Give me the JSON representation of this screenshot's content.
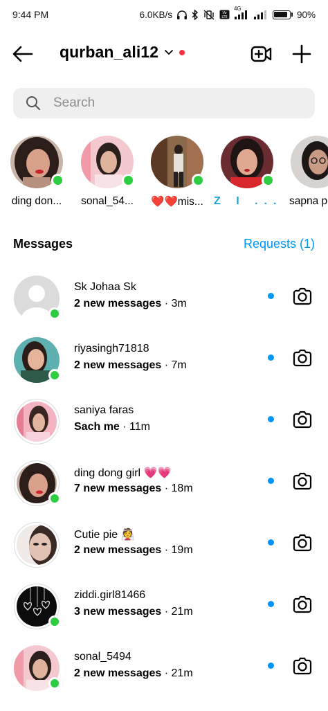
{
  "status_bar": {
    "time": "9:44 PM",
    "speed": "6.0KB/s",
    "network": "4G",
    "battery": "90",
    "battery_fraction": 0.9
  },
  "header": {
    "account_name": "qurban_ali12",
    "accent_red": "#ff3040"
  },
  "search": {
    "placeholder": "Search"
  },
  "stories": [
    {
      "label": "ding don...",
      "online": true
    },
    {
      "label": "sonal_54...",
      "online": true
    },
    {
      "label": "❤️❤️mis...",
      "online": true
    },
    {
      "label": "Z I ...",
      "online": true
    },
    {
      "label": "sapna p",
      "online": false
    }
  ],
  "messages_section": {
    "title": "Messages",
    "requests": "Requests (1)",
    "accent_blue": "#0095f6"
  },
  "threads": [
    {
      "name": "Sk Johaa Sk",
      "preview": "2 new messages",
      "time": " · 3m",
      "online": true,
      "unread": true
    },
    {
      "name": "riyasingh71818",
      "preview": "2 new messages",
      "time": " · 7m",
      "online": true,
      "unread": true
    },
    {
      "name": "saniya faras",
      "preview": "Sach me",
      "time": " · 11m",
      "online": false,
      "unread": true
    },
    {
      "name": "ding dong girl 💗💗",
      "preview": "7 new messages",
      "time": " · 18m",
      "online": true,
      "unread": true
    },
    {
      "name": "Cutie pie 👰",
      "preview": "2 new messages",
      "time": " · 19m",
      "online": false,
      "unread": true
    },
    {
      "name": "ziddi.girl81466",
      "preview": "3 new messages",
      "time": " · 21m",
      "online": true,
      "unread": true
    },
    {
      "name": "sonal_5494",
      "preview": "2 new messages",
      "time": " · 21m",
      "online": true,
      "unread": true
    }
  ]
}
